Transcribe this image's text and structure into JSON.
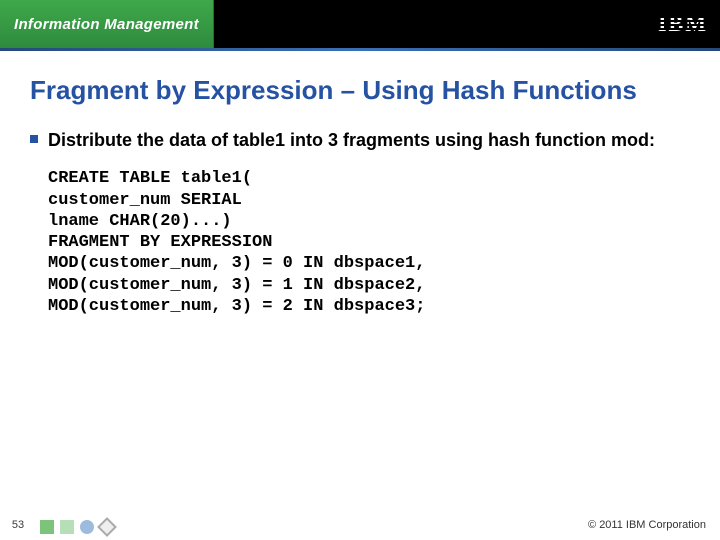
{
  "header": {
    "brand": "Information Management",
    "logo": "IBM"
  },
  "title": "Fragment by Expression – Using Hash Functions",
  "bullet": "Distribute the data of table1 into 3 fragments using hash function mod:",
  "code": "CREATE TABLE table1(\ncustomer_num SERIAL\nlname CHAR(20)...)\nFRAGMENT BY EXPRESSION\nMOD(customer_num, 3) = 0 IN dbspace1,\nMOD(customer_num, 3) = 1 IN dbspace2,\nMOD(customer_num, 3) = 2 IN dbspace3;",
  "footer": {
    "page": "53",
    "copyright": "© 2011 IBM Corporation"
  }
}
